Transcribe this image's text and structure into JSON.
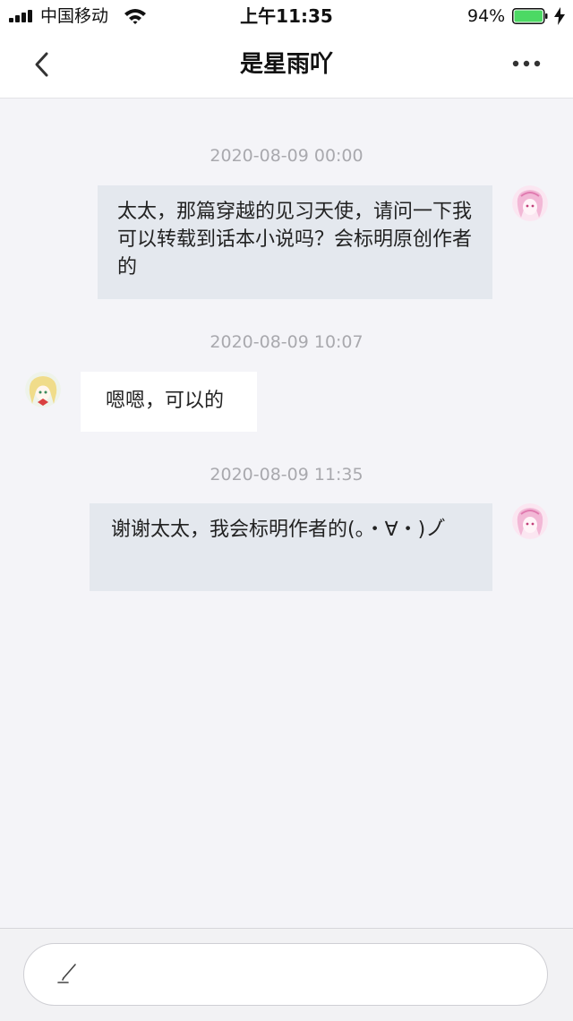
{
  "status_bar": {
    "carrier": "中国移动",
    "time": "上午11:35",
    "battery_percent": "94%",
    "battery_level": 0.94,
    "battery_color": "#4cd964"
  },
  "nav": {
    "title": "是星雨吖",
    "back_icon": "chevron-left-icon",
    "more_icon": "more-dots-icon"
  },
  "messages": [
    {
      "timestamp": "2020-08-09 00:00",
      "direction": "sent",
      "text": "太太，那篇穿越的见习天使，请问一下我可以转载到话本小说吗？会标明原创作者的"
    },
    {
      "timestamp": "2020-08-09 10:07",
      "direction": "received",
      "text": "嗯嗯，可以的"
    },
    {
      "timestamp": "2020-08-09 11:35",
      "direction": "sent",
      "text": "谢谢太太，我会标明作者的(。・∀・)ノ゙"
    }
  ],
  "input": {
    "icon": "pencil-icon",
    "value": ""
  },
  "colors": {
    "sent_bubble": "#e4e8ee",
    "received_bubble": "#ffffff",
    "background": "#f4f4f8",
    "timestamp": "#a9a9ae"
  }
}
